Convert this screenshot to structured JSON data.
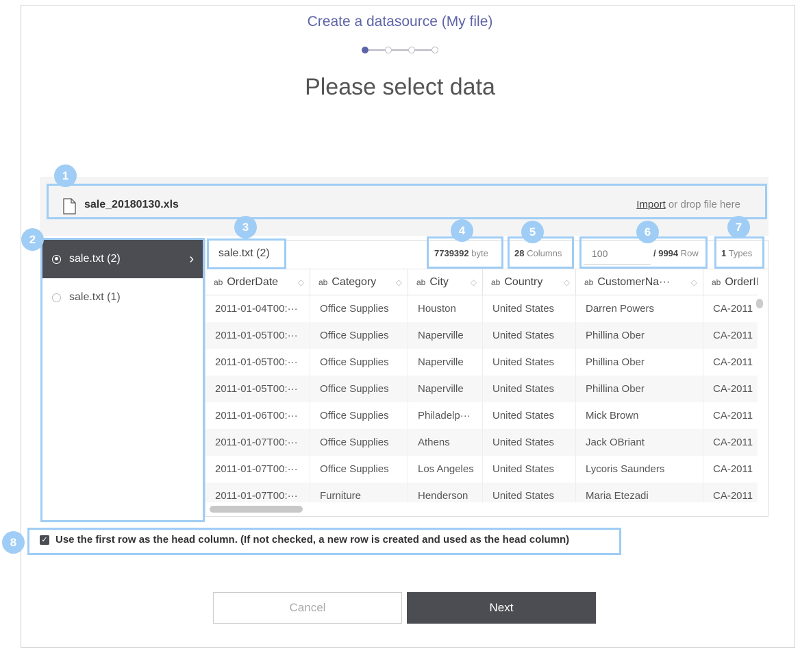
{
  "wizard": {
    "title": "Create a datasource (My file)",
    "page_title": "Please select data",
    "steps_total": 4,
    "step_current": 1
  },
  "file": {
    "name": "sale_20180130.xls",
    "import_label": "Import",
    "drop_text": " or drop file here"
  },
  "sheets": {
    "items": [
      {
        "label": "sale.txt (2)",
        "selected": true
      },
      {
        "label": "sale.txt (1)",
        "selected": false
      }
    ]
  },
  "grid": {
    "sheet_title": "sale.txt (2)",
    "size_value": "7739392",
    "size_unit": " byte",
    "columns_value": "28",
    "columns_unit": " Columns",
    "row_input_value": "100",
    "rows_total": "/ 9994",
    "rows_unit": " Row",
    "types_value": "1",
    "types_unit": " Types",
    "columns": [
      {
        "type": "ab",
        "name": "OrderDate"
      },
      {
        "type": "ab",
        "name": "Category"
      },
      {
        "type": "ab",
        "name": "City"
      },
      {
        "type": "ab",
        "name": "Country"
      },
      {
        "type": "ab",
        "name": "CustomerNa···"
      },
      {
        "type": "ab",
        "name": "OrderID"
      }
    ],
    "rows": [
      [
        "2011-01-04T00:···",
        "Office Supplies",
        "Houston",
        "United States",
        "Darren Powers",
        "CA-2011"
      ],
      [
        "2011-01-05T00:···",
        "Office Supplies",
        "Naperville",
        "United States",
        "Phillina Ober",
        "CA-2011"
      ],
      [
        "2011-01-05T00:···",
        "Office Supplies",
        "Naperville",
        "United States",
        "Phillina Ober",
        "CA-2011"
      ],
      [
        "2011-01-05T00:···",
        "Office Supplies",
        "Naperville",
        "United States",
        "Phillina Ober",
        "CA-2011"
      ],
      [
        "2011-01-06T00:···",
        "Office Supplies",
        "Philadelp···",
        "United States",
        "Mick Brown",
        "CA-2011"
      ],
      [
        "2011-01-07T00:···",
        "Office Supplies",
        "Athens",
        "United States",
        "Jack OBriant",
        "CA-2011"
      ],
      [
        "2011-01-07T00:···",
        "Office Supplies",
        "Los Angeles",
        "United States",
        "Lycoris Saunders",
        "CA-2011"
      ],
      [
        "2011-01-07T00:···",
        "Furniture",
        "Henderson",
        "United States",
        "Maria Etezadi",
        "CA-2011"
      ]
    ]
  },
  "options": {
    "head_column_checked": true,
    "head_column_label": "Use the first row as the head column. (If not checked, a new row is created and used as the head column)"
  },
  "buttons": {
    "cancel": "Cancel",
    "next": "Next"
  },
  "badges": [
    "1",
    "2",
    "3",
    "4",
    "5",
    "6",
    "7",
    "8"
  ],
  "colors": {
    "accent": "#5d63a8",
    "highlight": "#9fcdf5",
    "dark": "#4b4d53"
  }
}
